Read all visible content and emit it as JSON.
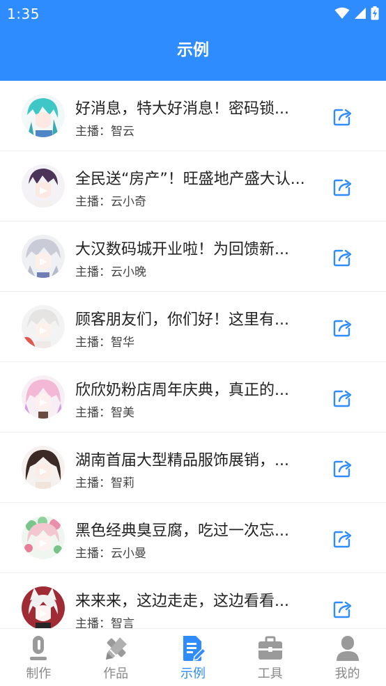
{
  "status": {
    "time": "1:35"
  },
  "header": {
    "title": "示例"
  },
  "colors": {
    "accent": "#2f8cff",
    "inactive": "#9a9a9a"
  },
  "items": [
    {
      "title": "好消息，特大好消息！密码锁...",
      "host": "主播：智云",
      "avatar": "teal-hair-avatar"
    },
    {
      "title": "全民送“房产”！旺盛地产盛大认...",
      "host": "主播：云小奇",
      "avatar": "purple-hair-avatar"
    },
    {
      "title": "大汉数码城开业啦！为回馈新...",
      "host": "主播：云小晚",
      "avatar": "silver-hair-avatar"
    },
    {
      "title": "顾客朋友们，你们好！这里有...",
      "host": "主播：智华",
      "avatar": "white-hair-avatar"
    },
    {
      "title": "欣欣奶粉店周年庆典，真正的...",
      "host": "主播：智美",
      "avatar": "pink-hair-avatar"
    },
    {
      "title": "湖南首届大型精品服饰展销，...",
      "host": "主播：智莉",
      "avatar": "dark-hair-avatar"
    },
    {
      "title": "黑色经典臭豆腐，吃过一次忘...",
      "host": "主播：云小曼",
      "avatar": "floral-hair-avatar"
    },
    {
      "title": "来来来，这边走走，这边看看...",
      "host": "主播：智言",
      "avatar": "fox-ear-avatar"
    }
  ],
  "nav": [
    {
      "label": "制作",
      "icon": "microphone-icon",
      "active": false
    },
    {
      "label": "作品",
      "icon": "pencil-ruler-icon",
      "active": false
    },
    {
      "label": "示例",
      "icon": "document-edit-icon",
      "active": true
    },
    {
      "label": "工具",
      "icon": "toolbox-icon",
      "active": false
    },
    {
      "label": "我的",
      "icon": "user-icon",
      "active": false
    }
  ]
}
